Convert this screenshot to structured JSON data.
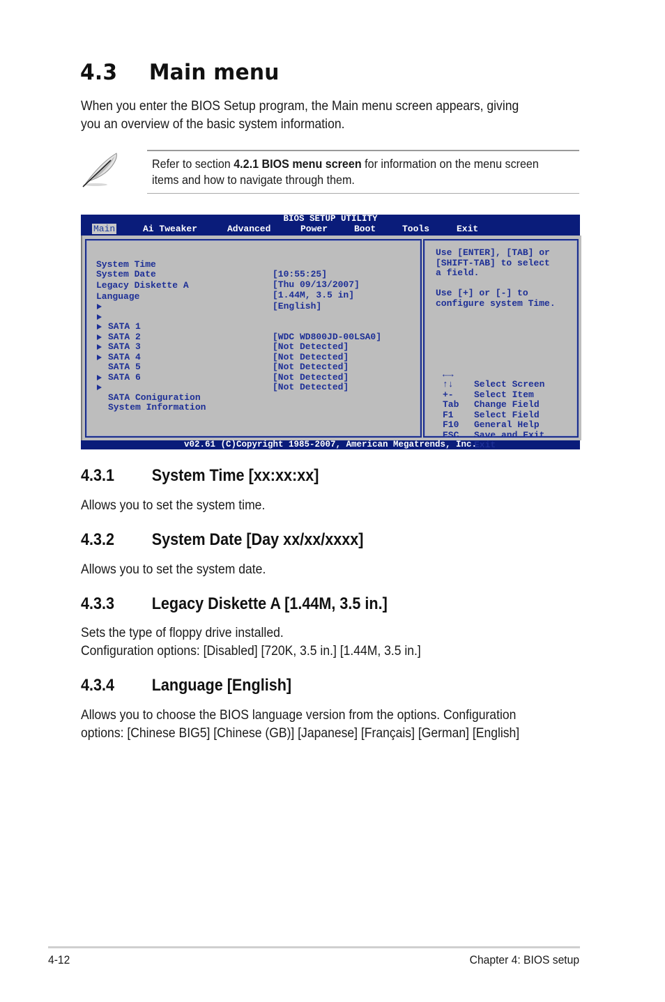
{
  "heading": {
    "number": "4.3",
    "title": "Main menu"
  },
  "intro": [
    "When you enter the BIOS Setup program, the Main menu screen appears, giving",
    "you an overview of the basic system information."
  ],
  "note": {
    "icon": "feather-pen-icon",
    "prefix": "Refer to section ",
    "bold": "4.2.1  BIOS menu screen",
    "suffix": " for information on the menu screen",
    "line2": "items and how to navigate through them."
  },
  "bios": {
    "title": "BIOS SETUP UTILITY",
    "menu": [
      {
        "label": "Main",
        "active": true
      },
      {
        "label": "Ai Tweaker",
        "active": false
      },
      {
        "label": "Advanced",
        "active": false
      },
      {
        "label": "Power",
        "active": false
      },
      {
        "label": "Boot",
        "active": false
      },
      {
        "label": "Tools",
        "active": false
      },
      {
        "label": "Exit",
        "active": false
      }
    ],
    "settings": [
      {
        "label": "System Time",
        "value": "[10:55:25]"
      },
      {
        "label": "System Date",
        "value": "[Thu 09/13/2007]"
      },
      {
        "label": "Legacy Diskette A",
        "value": "[1.44M, 3.5 in]"
      },
      {
        "label": "Language",
        "value": "[English]"
      }
    ],
    "sata": [
      {
        "label": "SATA 1",
        "value": "[WDC WD800JD-00LSA0]"
      },
      {
        "label": "SATA 2",
        "value": "[Not Detected]"
      },
      {
        "label": "SATA 3",
        "value": "[Not Detected]"
      },
      {
        "label": "SATA 4",
        "value": "[Not Detected]"
      },
      {
        "label": "SATA 5",
        "value": "[Not Detected]"
      },
      {
        "label": "SATA 6",
        "value": "[Not Detected]"
      }
    ],
    "submenus": [
      {
        "label": "SATA Coniguration"
      },
      {
        "label": "System Information"
      }
    ],
    "help": [
      "Use [ENTER], [TAB] or",
      "[SHIFT-TAB] to select",
      "a field.",
      "",
      "Use [+] or [-] to",
      "configure system Time."
    ],
    "keys": [
      {
        "key": "←→",
        "desc": "Select Screen",
        "icon": "left-right-arrows-icon"
      },
      {
        "key": "↑↓",
        "desc": "Select Item",
        "icon": "up-down-arrows-icon"
      },
      {
        "key": "+-",
        "desc": "Change Field"
      },
      {
        "key": "Tab",
        "desc": "Select Field"
      },
      {
        "key": "F1",
        "desc": "General Help"
      },
      {
        "key": "F10",
        "desc": "Save and Exit"
      },
      {
        "key": "ESC",
        "desc": "Exit"
      }
    ],
    "footer": "v02.61 (C)Copyright 1985-2007, American Megatrends, Inc.",
    "colors": {
      "frame": "#0a1c7a",
      "panel": "#bdbdbd",
      "text": "#1d2f96",
      "active_tab_bg": "#c8c8c8"
    }
  },
  "sections": [
    {
      "number": "4.3.1",
      "title": "System Time [xx:xx:xx]",
      "body": [
        "Allows you to set the system time."
      ]
    },
    {
      "number": "4.3.2",
      "title": "System Date [Day xx/xx/xxxx]",
      "body": [
        "Allows you to set the system date."
      ]
    },
    {
      "number": "4.3.3",
      "title": "Legacy Diskette A [1.44M, 3.5 in.]",
      "body": [
        "Sets the type of floppy drive installed.",
        "Configuration options: [Disabled] [720K, 3.5 in.] [1.44M, 3.5 in.]"
      ]
    },
    {
      "number": "4.3.4",
      "title": "Language [English]",
      "body": [
        "Allows you to choose the BIOS language version from the options. Configuration",
        "options: [Chinese BIG5] [Chinese (GB)] [Japanese] [Français] [German] [English]"
      ]
    }
  ],
  "footer": {
    "page": "4-12",
    "chapter": "Chapter 4: BIOS setup"
  }
}
